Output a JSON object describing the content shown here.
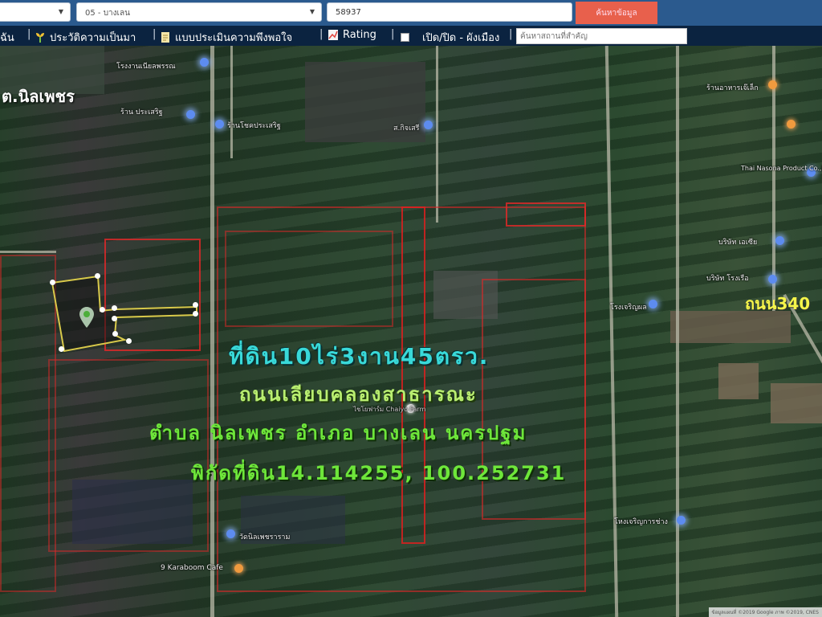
{
  "toolbar": {
    "province_select": {
      "value": ""
    },
    "district_select": {
      "value": "05 - บางเลน"
    },
    "parcel_code_input": {
      "value": "58937"
    },
    "search_button": "ค้นหาข้อมูล"
  },
  "nav": {
    "items": [
      {
        "label": "ฉัน",
        "icon": "user-icon"
      },
      {
        "label": "ประวัติความเป็นมา",
        "icon": "sprout-icon"
      },
      {
        "label": "แบบประเมินความพึงพอใจ",
        "icon": "document-icon"
      },
      {
        "label": "Rating",
        "icon": "chart-icon"
      },
      {
        "label": "เปิด/ปิด - ผังเมือง",
        "icon": "checkbox-icon"
      }
    ],
    "place_search_placeholder": "ค้นหาสถานที่สำคัญ"
  },
  "map": {
    "overlay_text": {
      "area": "ที่ดิน10ไร่3งาน45ตรว.",
      "road": "ถนนเลียบคลองสาธารณะ",
      "location": "ตำบล นิลเพชร อำเภอ บางเลน นครปฐม",
      "coordinates": "พิกัดที่ดิน14.114255, 100.252731"
    },
    "subdistrict_label": "ต.นิลเพชร",
    "road_label": "ถนน340",
    "pois": [
      {
        "label": "โรงงานเนียลพรรณ",
        "type": "blue"
      },
      {
        "label": "ร้าน ประเสริฐ",
        "type": "blue"
      },
      {
        "label": "ร้านโชคประเสริฐ",
        "type": "blue"
      },
      {
        "label": "ส.กิจเสรี",
        "type": "blue"
      },
      {
        "label": "ร้านอาหารเจ๊เล็ก",
        "type": "orange"
      },
      {
        "label": "Thai Nasona Product Co.,Ltd",
        "type": "blue"
      },
      {
        "label": "บริษัท เอเซีย",
        "type": "blue"
      },
      {
        "label": "บริษัท โรงเรือ",
        "type": "blue"
      },
      {
        "label": "โรงเจริญผล",
        "type": "blue"
      },
      {
        "label": "ไชโยฟาร์ม Chaiyo Farm",
        "type": "white"
      },
      {
        "label": "วัดนิลเพชราราม",
        "type": "blue"
      },
      {
        "label": "9 Karaboom Cafe",
        "type": "orange"
      },
      {
        "label": "โหงเจริญการช่าง",
        "type": "blue"
      }
    ],
    "attribution": "ข้อมูลแผนที่ ©2019 Google ภาพ ©2019, CNES"
  }
}
